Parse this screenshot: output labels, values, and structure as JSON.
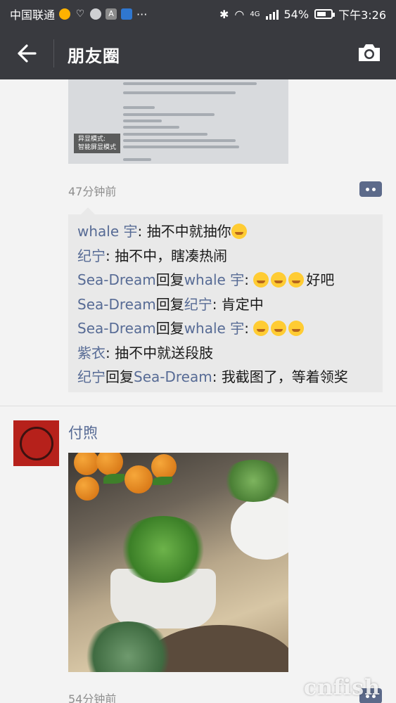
{
  "status_bar": {
    "carrier": "中国联通",
    "more": "···",
    "network": "4G",
    "battery": "54%",
    "battery_level": 0.54,
    "time": "下午3:26"
  },
  "header": {
    "title": "朋友圈",
    "back_icon": "arrow-left-icon",
    "camera_icon": "camera-icon"
  },
  "post1": {
    "image_badge_line1": "异显模式:",
    "image_badge_line2": "智能屏显模式",
    "time": "47分钟前",
    "comments": [
      {
        "name": "whale 宇",
        "sep": ": ",
        "text": "抽不中就抽你",
        "emoji": 1
      },
      {
        "name": "纪宁",
        "sep": ": ",
        "text": "抽不中，瞎凑热闹"
      },
      {
        "name": "Sea-Dream",
        "reply": "回复",
        "target": "whale 宇",
        "sep": ": ",
        "emoji_before": 3,
        "text": "好吧"
      },
      {
        "name": "Sea-Dream",
        "reply": "回复",
        "target": "纪宁",
        "sep": ": ",
        "text": "肯定中"
      },
      {
        "name": "Sea-Dream",
        "reply": "回复",
        "target": "whale 宇",
        "sep": ": ",
        "emoji_before": 3,
        "text": ""
      },
      {
        "name": "紫衣",
        "sep": ": ",
        "text": "抽不中就送段肢"
      },
      {
        "name": "纪宁",
        "reply": "回复",
        "target": "Sea-Dream",
        "sep": ": ",
        "text": "我截图了，等着领奖"
      }
    ]
  },
  "post2": {
    "author": "付煦",
    "time": "54分钟前"
  },
  "watermark": "cnfish"
}
